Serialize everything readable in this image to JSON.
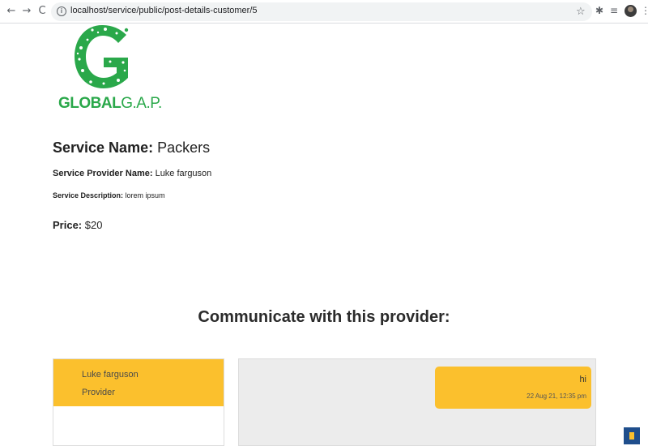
{
  "browser": {
    "url": "localhost/service/public/post-details-customer/5",
    "back_icon": "←",
    "forward_icon": "→",
    "reload_icon": "C",
    "info_icon": "i",
    "star_icon": "☆",
    "extensions_icon": "✱",
    "reading_list_icon": "≡",
    "menu_icon": "⋮"
  },
  "logo": {
    "word_bold": "GLOBAL",
    "word_thin": "G.A.P.",
    "color": "#2aa84a"
  },
  "service": {
    "name_label": "Service Name:",
    "name_value": " Packers",
    "provider_label": "Service Provider Name:",
    "provider_value": " Luke farguson",
    "description_label": "Service Description:",
    "description_value": " lorem ipsum",
    "price_label": "Price:",
    "price_value": " $20"
  },
  "section": {
    "heading": "Communicate with this provider:"
  },
  "contacts": [
    {
      "name": "Luke farguson",
      "role": "Provider"
    }
  ],
  "messages": [
    {
      "text": "hi",
      "time": "22 Aug 21, 12:35 pm"
    }
  ],
  "colors": {
    "accent": "#fbc02d",
    "chat_bg": "#ececec",
    "scroll_button": "#1f4e8c"
  }
}
